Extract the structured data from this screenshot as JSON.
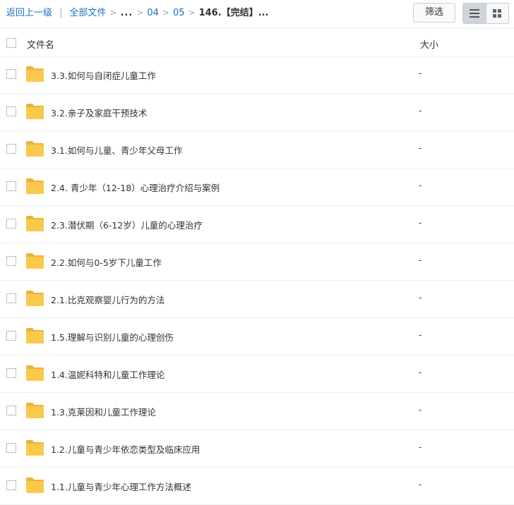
{
  "toolbar": {
    "back_label": "返回上一级",
    "all_files_label": "全部文件",
    "ellipsis": "...",
    "crumbs": [
      "04",
      "05"
    ],
    "current_folder": "146.【完结】...",
    "filter_label": "筛选"
  },
  "table": {
    "col_name": "文件名",
    "col_size": "大小",
    "rows": [
      {
        "name": "3.3.如何与自闭症儿童工作",
        "size": "-"
      },
      {
        "name": "3.2.亲子及家庭干预技术",
        "size": "-"
      },
      {
        "name": "3.1.如何与儿童、青少年父母工作",
        "size": "-"
      },
      {
        "name": "2.4. 青少年（12-18）心理治疗介绍与案例",
        "size": "-"
      },
      {
        "name": "2.3.潜伏期（6-12岁）儿童的心理治疗",
        "size": "-"
      },
      {
        "name": "2.2.如何与0-5岁下儿童工作",
        "size": "-"
      },
      {
        "name": "2.1.比克观察婴儿行为的方法",
        "size": "-"
      },
      {
        "name": "1.5.理解与识别儿童的心理创伤",
        "size": "-"
      },
      {
        "name": "1.4.温妮科特和儿童工作理论",
        "size": "-"
      },
      {
        "name": "1.3.克莱因和儿童工作理论",
        "size": "-"
      },
      {
        "name": "1.2.儿童与青少年依恋类型及临床应用",
        "size": "-"
      },
      {
        "name": "1.1.儿童与青少年心理工作方法概述",
        "size": "-"
      }
    ]
  },
  "icons": {
    "folder": "folder-icon",
    "list_view": "list-view-icon",
    "grid_view": "grid-view-icon"
  },
  "colors": {
    "link": "#1a6fc4",
    "folder": "#f8c94b",
    "folder_tab": "#eeb13a"
  }
}
